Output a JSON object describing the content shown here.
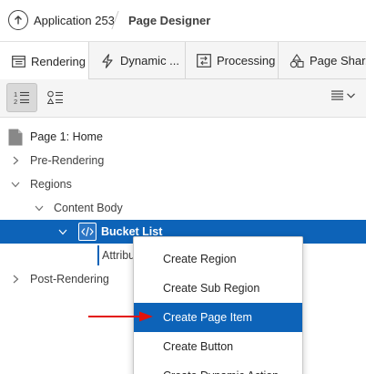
{
  "header": {
    "app_name": "Application 253",
    "page_name": "Page Designer"
  },
  "tabs": [
    {
      "label": "Rendering",
      "icon": "rendering-icon",
      "active": true
    },
    {
      "label": "Dynamic ...",
      "icon": "lightning-icon",
      "active": false
    },
    {
      "label": "Processing",
      "icon": "processing-icon",
      "active": false
    },
    {
      "label": "Page Shar...",
      "icon": "shapes-icon",
      "active": false
    }
  ],
  "tree": {
    "page_label": "Page 1: Home",
    "pre_rendering": "Pre-Rendering",
    "regions": "Regions",
    "content_body": "Content Body",
    "bucket_list": "Bucket List",
    "attributes_partial": "Attribu",
    "post_rendering": "Post-Rendering"
  },
  "context_menu": {
    "items": [
      "Create Region",
      "Create Sub Region",
      "Create Page Item",
      "Create Button",
      "Create Dynamic Action"
    ],
    "highlighted_index": 2
  },
  "colors": {
    "selection_blue": "#0d63b8",
    "arrow_red": "#e3130b"
  }
}
